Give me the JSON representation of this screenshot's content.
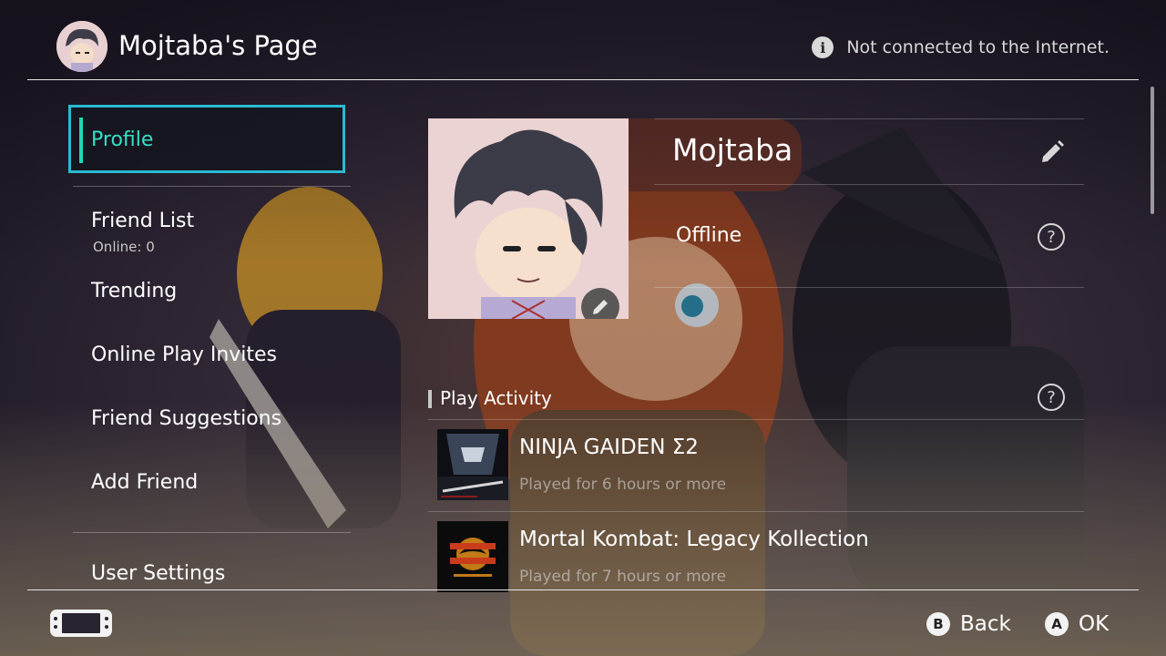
{
  "header": {
    "title": "Mojtaba's Page",
    "connection_status": "Not connected to the Internet.",
    "info_icon": "info-icon"
  },
  "sidebar": {
    "items": [
      {
        "label": "Profile",
        "selected": true
      },
      {
        "label": "Friend List",
        "sublabel": "Online: 0"
      },
      {
        "label": "Trending"
      },
      {
        "label": "Online Play Invites"
      },
      {
        "label": "Friend Suggestions"
      },
      {
        "label": "Add Friend"
      },
      {
        "label": "User Settings"
      }
    ]
  },
  "profile": {
    "nickname": "Mojtaba",
    "status": "Offline",
    "activity_heading": "Play Activity",
    "games": [
      {
        "title": "NINJA GAIDEN Σ2",
        "played": "Played for 6 hours or more"
      },
      {
        "title": "Mortal Kombat: Legacy Kollection",
        "played": "Played for 7 hours or more"
      }
    ]
  },
  "footer": {
    "back_key": "B",
    "back_label": "Back",
    "ok_key": "A",
    "ok_label": "OK"
  },
  "colors": {
    "selection_border": "#2ab9d3",
    "selection_text": "#33e0c6",
    "background": "#2c2636"
  }
}
